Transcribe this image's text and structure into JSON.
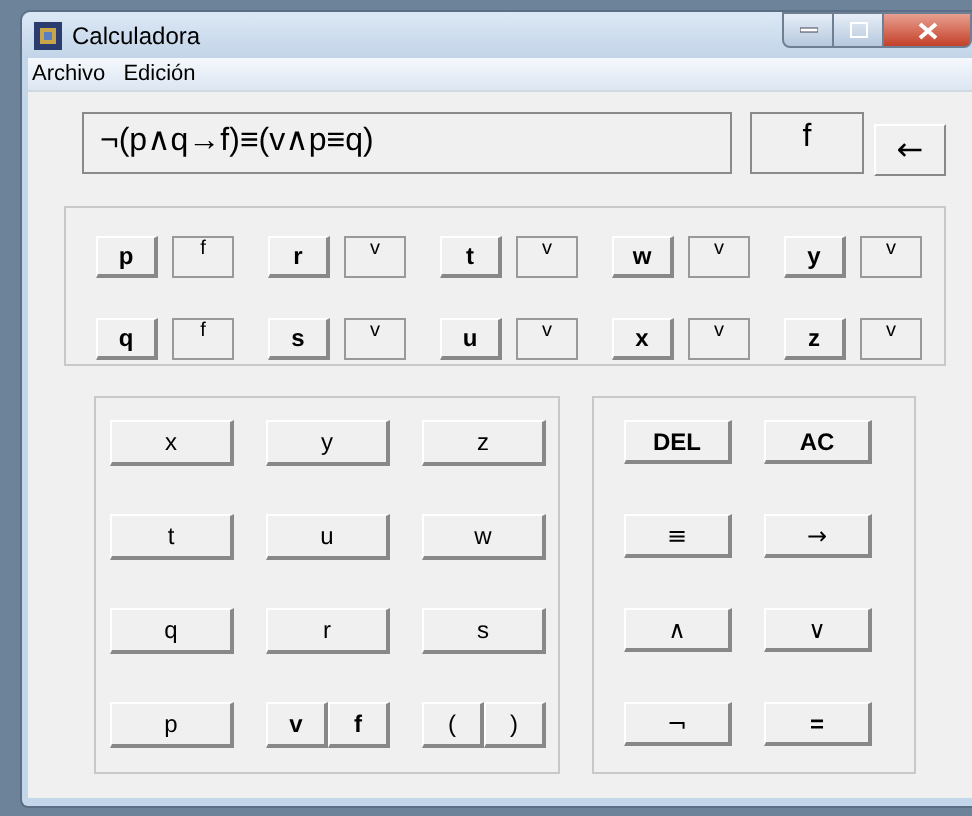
{
  "window": {
    "title": "Calculadora"
  },
  "menu": [
    "Archivo",
    "Edición"
  ],
  "expression": "¬(p∧q→f)≡(v∧p≡q)",
  "result": "f",
  "back_button": "←",
  "variables": [
    {
      "name": "p",
      "value": "f"
    },
    {
      "name": "r",
      "value": "v"
    },
    {
      "name": "t",
      "value": "v"
    },
    {
      "name": "w",
      "value": "v"
    },
    {
      "name": "y",
      "value": "v"
    },
    {
      "name": "q",
      "value": "f"
    },
    {
      "name": "s",
      "value": "v"
    },
    {
      "name": "u",
      "value": "v"
    },
    {
      "name": "x",
      "value": "v"
    },
    {
      "name": "z",
      "value": "v"
    }
  ],
  "keypad": [
    {
      "kind": "single",
      "label": "x"
    },
    {
      "kind": "single",
      "label": "y"
    },
    {
      "kind": "single",
      "label": "z"
    },
    {
      "kind": "single",
      "label": "t"
    },
    {
      "kind": "single",
      "label": "u"
    },
    {
      "kind": "single",
      "label": "w"
    },
    {
      "kind": "single",
      "label": "q"
    },
    {
      "kind": "single",
      "label": "r"
    },
    {
      "kind": "single",
      "label": "s"
    },
    {
      "kind": "single",
      "label": "p"
    },
    {
      "kind": "pair",
      "labels": [
        "v",
        "f"
      ],
      "bold": true
    },
    {
      "kind": "pair",
      "labels": [
        "(",
        ")"
      ],
      "bold": false
    }
  ],
  "operators": [
    {
      "label": "DEL",
      "bold": true
    },
    {
      "label": "AC",
      "bold": true
    },
    {
      "label": "≡",
      "bold": false
    },
    {
      "label": "→",
      "bold": false
    },
    {
      "label": "∧",
      "bold": false
    },
    {
      "label": "∨",
      "bold": false
    },
    {
      "label": "¬",
      "bold": false
    },
    {
      "label": "=",
      "bold": true
    }
  ]
}
